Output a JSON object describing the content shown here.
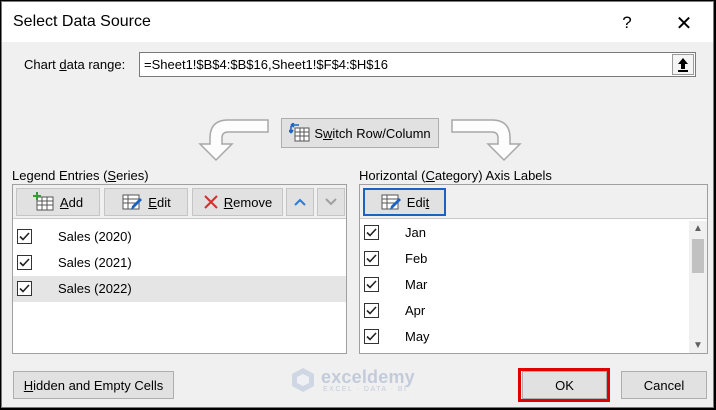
{
  "window": {
    "title": "Select Data Source",
    "help_glyph": "?",
    "close_glyph": "✕"
  },
  "range": {
    "label_pre": "Chart ",
    "label_u": "d",
    "label_post": "ata range:",
    "value": "=Sheet1!$B$4:$B$16,Sheet1!$F$4:$H$16"
  },
  "switch_button": {
    "label_pre": "S",
    "label_u": "w",
    "label_post": "itch Row/Column"
  },
  "legend": {
    "label_pre": "Legend Entries (",
    "label_u": "S",
    "label_post": "eries)",
    "add": {
      "label_u": "A",
      "label_post": "dd"
    },
    "edit": {
      "label_u": "E",
      "label_post": "dit"
    },
    "remove": {
      "label_u": "R",
      "label_post": "emove"
    },
    "entries": [
      {
        "label": "Sales (2020)",
        "checked": true
      },
      {
        "label": "Sales (2021)",
        "checked": true
      },
      {
        "label": "Sales (2022)",
        "checked": true,
        "selected": true
      }
    ]
  },
  "axis": {
    "label_pre": "Horizontal (",
    "label_u": "C",
    "label_post": "ategory) Axis Labels",
    "edit": {
      "label_pre": "Edi",
      "label_u": "t"
    },
    "entries": [
      {
        "label": "Jan",
        "checked": true
      },
      {
        "label": "Feb",
        "checked": true
      },
      {
        "label": "Mar",
        "checked": true
      },
      {
        "label": "Apr",
        "checked": true
      },
      {
        "label": "May",
        "checked": true
      }
    ]
  },
  "bottom": {
    "hidden_pre": "",
    "hidden_u": "H",
    "hidden_post": "idden and Empty Cells",
    "ok": "OK",
    "cancel": "Cancel"
  },
  "watermark": {
    "name": "exceldemy",
    "tagline": "EXCEL · DATA · BI"
  },
  "colors": {
    "highlight": "#e00000",
    "selected_row": "#e5e5e5",
    "button": "#e1e1e1"
  }
}
